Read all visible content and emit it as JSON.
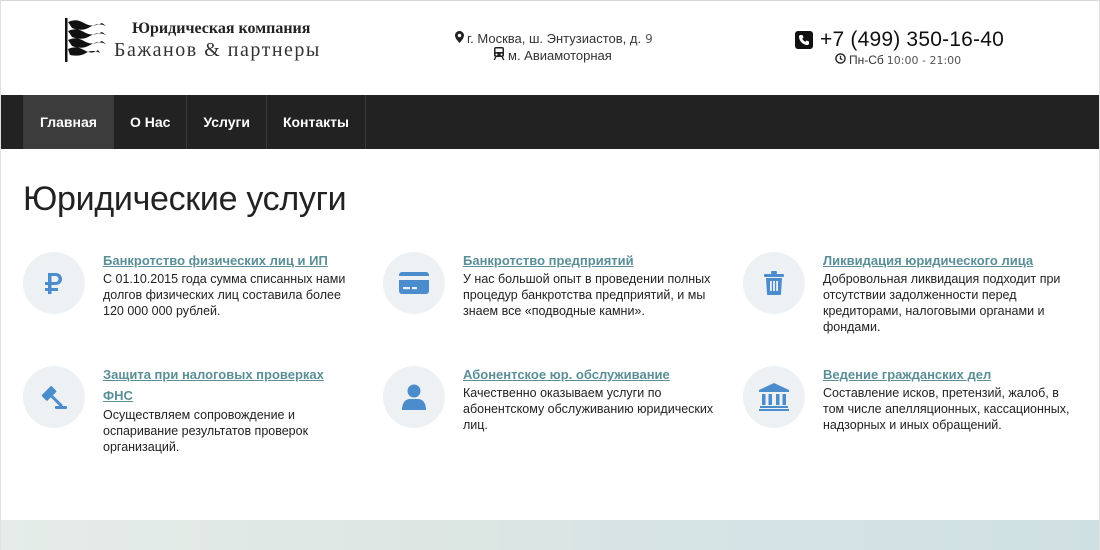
{
  "header": {
    "logo": {
      "line1": "Юридическая компания",
      "line2": "Бажанов & партнеры",
      "icon": "flag-logo-icon"
    },
    "address": {
      "street": "г. Москва, ш. Энтузиастов, д.",
      "house": "9",
      "metro": "м. Авиамоторная",
      "street_icon": "map-marker-icon",
      "metro_icon": "metro-train-icon"
    },
    "contact": {
      "phone": "+7 (499) 350-16-40",
      "days": "Пн-Сб",
      "hours": "10:00 - 21:00",
      "phone_icon": "phone-icon",
      "clock_icon": "clock-icon"
    }
  },
  "nav": {
    "items": [
      {
        "label": "Главная",
        "active": true
      },
      {
        "label": "О Нас",
        "active": false
      },
      {
        "label": "Услуги",
        "active": false
      },
      {
        "label": "Контакты",
        "active": false
      }
    ]
  },
  "main": {
    "title": "Юридические услуги",
    "icon_color": "#4a8ccc",
    "link_color": "#5b8f97",
    "services": [
      {
        "icon": "ruble-icon",
        "title": "Банкротство физических лиц и ИП",
        "text": "С 01.10.2015 года сумма списанных нами долгов физических лиц составила более 120 000 000 рублей."
      },
      {
        "icon": "credit-card-icon",
        "title": "Банкротство предприятий",
        "text": "У нас большой опыт в проведении полных процедур банкротства предприятий, и мы знаем все «подводные камни»."
      },
      {
        "icon": "trash-icon",
        "title": "Ликвидация юридического лица",
        "text": "Добровольная ликвидация подходит при отсутствии задолженности перед кредиторами, налоговыми органами и фондами."
      },
      {
        "icon": "gavel-icon",
        "title": "Защита при налоговых проверках ФНС",
        "text": "Осуществляем сопровождение и оспаривание результатов проверок организаций."
      },
      {
        "icon": "user-icon",
        "title": "Абонентское юр. обслуживание",
        "text": "Качественно оказываем услуги по абонентскому обслуживанию юридических лиц."
      },
      {
        "icon": "bank-building-icon",
        "title": "Ведение гражданских дел",
        "text": "Составление исков, претензий, жалоб, в том числе апелляционных, кассационных, надзорных и иных обращений."
      }
    ]
  }
}
